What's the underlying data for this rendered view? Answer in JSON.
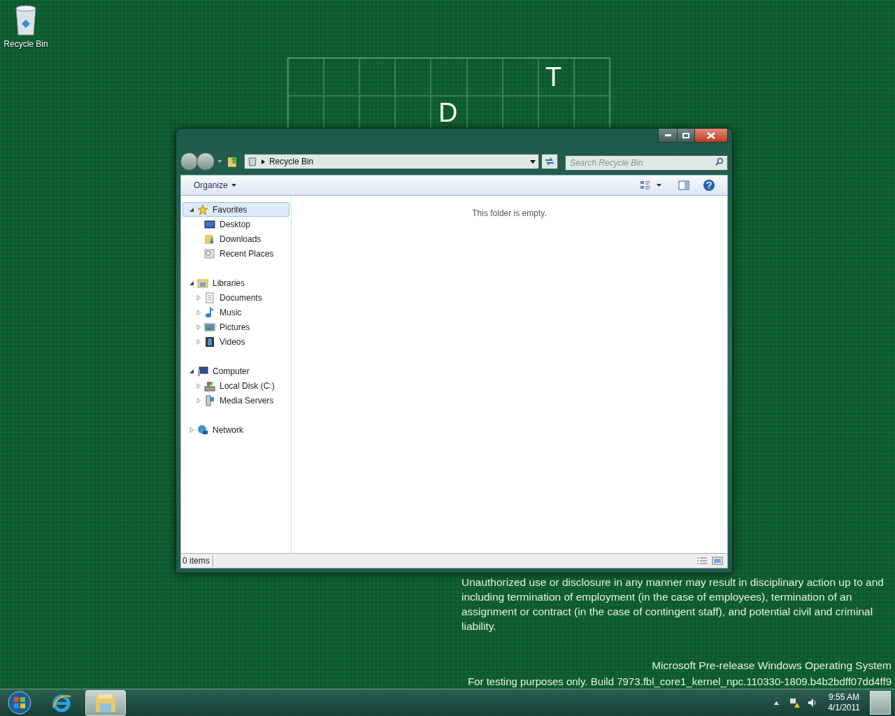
{
  "desktop_icons": [
    {
      "label": "Recycle Bin"
    }
  ],
  "wallpaper_letters": [
    {
      "text": "T"
    },
    {
      "text": "D"
    }
  ],
  "window": {
    "address": {
      "path": "Recycle Bin"
    },
    "search": {
      "placeholder": "Search Recycle Bin"
    },
    "toolbar": {
      "organize": "Organize"
    },
    "nav": [
      {
        "label": "Favorites",
        "kind": "star",
        "expanded": true,
        "selected": true,
        "children": [
          {
            "label": "Desktop",
            "kind": "desktop"
          },
          {
            "label": "Downloads",
            "kind": "downloads"
          },
          {
            "label": "Recent Places",
            "kind": "recent"
          }
        ]
      },
      {
        "label": "Libraries",
        "kind": "library",
        "expanded": true,
        "selected": false,
        "children": [
          {
            "label": "Documents",
            "kind": "document",
            "expanded": false
          },
          {
            "label": "Music",
            "kind": "music",
            "expanded": false
          },
          {
            "label": "Pictures",
            "kind": "picture",
            "expanded": false
          },
          {
            "label": "Videos",
            "kind": "video",
            "expanded": false
          }
        ]
      },
      {
        "label": "Computer",
        "kind": "computer",
        "expanded": true,
        "selected": false,
        "children": [
          {
            "label": "Local Disk (C:)",
            "kind": "disk",
            "expanded": false
          },
          {
            "label": "Media Servers",
            "kind": "server",
            "expanded": false
          }
        ]
      },
      {
        "label": "Network",
        "kind": "network",
        "expanded": false,
        "selected": false
      }
    ],
    "empty_message": "This folder is empty.",
    "status": "0 items"
  },
  "notice": {
    "paragraph": "Unauthorized use or disclosure in any manner may result in disciplinary action up to and including termination of employment (in the case of employees), termination of an assignment or contract (in the case of contingent staff), and potential civil and criminal liability.",
    "os_name": "Microsoft Pre-release Windows Operating System",
    "build": "For testing purposes only. Build 7973.fbl_core1_kernel_npc.110330-1809.b4b2bdff07dd4ff9"
  },
  "taskbar": {
    "items": [
      {
        "kind": "start",
        "selected": false
      },
      {
        "kind": "browser",
        "selected": false
      },
      {
        "kind": "explorer",
        "selected": true
      }
    ],
    "clock": {
      "time": "9:55 AM",
      "date": "4/1/2011"
    }
  }
}
